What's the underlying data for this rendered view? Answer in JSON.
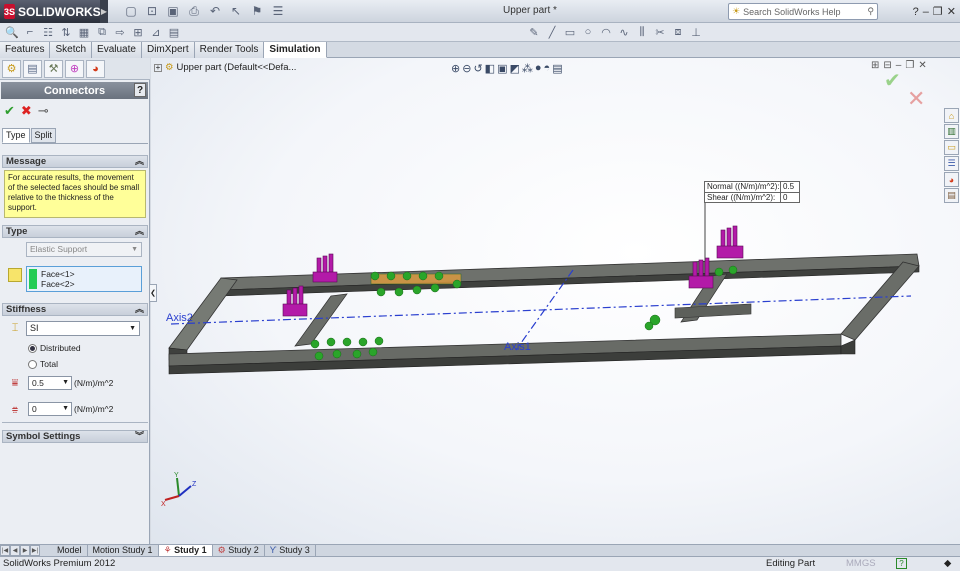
{
  "app": {
    "logo": "SOLIDWORKS",
    "document_title": "Upper part *",
    "help_search_placeholder": "Search SolidWorks Help",
    "help_label": "?"
  },
  "cm_tabs": [
    "Features",
    "Sketch",
    "Evaluate",
    "DimXpert",
    "Render Tools",
    "Simulation"
  ],
  "property_manager": {
    "title": "Connectors",
    "help": "?",
    "sub_tabs": [
      "Type",
      "Split"
    ],
    "message_header": "Message",
    "message_text": "For accurate results, the movement of the selected faces should be small relative to the thickness of the support.",
    "type_header": "Type",
    "type_value": "Elastic Support",
    "faces": [
      "Face<1>",
      "Face<2>"
    ],
    "stiffness_header": "Stiffness",
    "unit_system": "SI",
    "distributed_label": "Distributed",
    "total_label": "Total",
    "normal_value": "0.5",
    "shear_value": "0",
    "stiffness_unit": "(N/m)/m^2",
    "symbol_settings_header": "Symbol Settings"
  },
  "graphics": {
    "tree_root": "Upper part  (Default<<Defa...",
    "stiffness_callout": [
      {
        "label": "Normal ((N/m)/m^2):",
        "value": "0.5"
      },
      {
        "label": "Shear ((N/m)/m^2):",
        "value": "0"
      }
    ],
    "axis_labels": [
      "Axis2",
      "Axis1"
    ]
  },
  "bottom_tabs": [
    "Model",
    "Motion Study 1",
    "Study 1",
    "Study 2",
    "Study 3"
  ],
  "status_bar": {
    "product": "SolidWorks Premium 2012",
    "mode": "Editing Part",
    "units": "MMGS",
    "help": "?"
  },
  "colors": {
    "support_arrow": "#b31aa8",
    "connector_green": "#2aa52a",
    "axis_blue": "#2a3fcf",
    "beam": "#5c5e5a",
    "message_bg": "#ffff99"
  }
}
